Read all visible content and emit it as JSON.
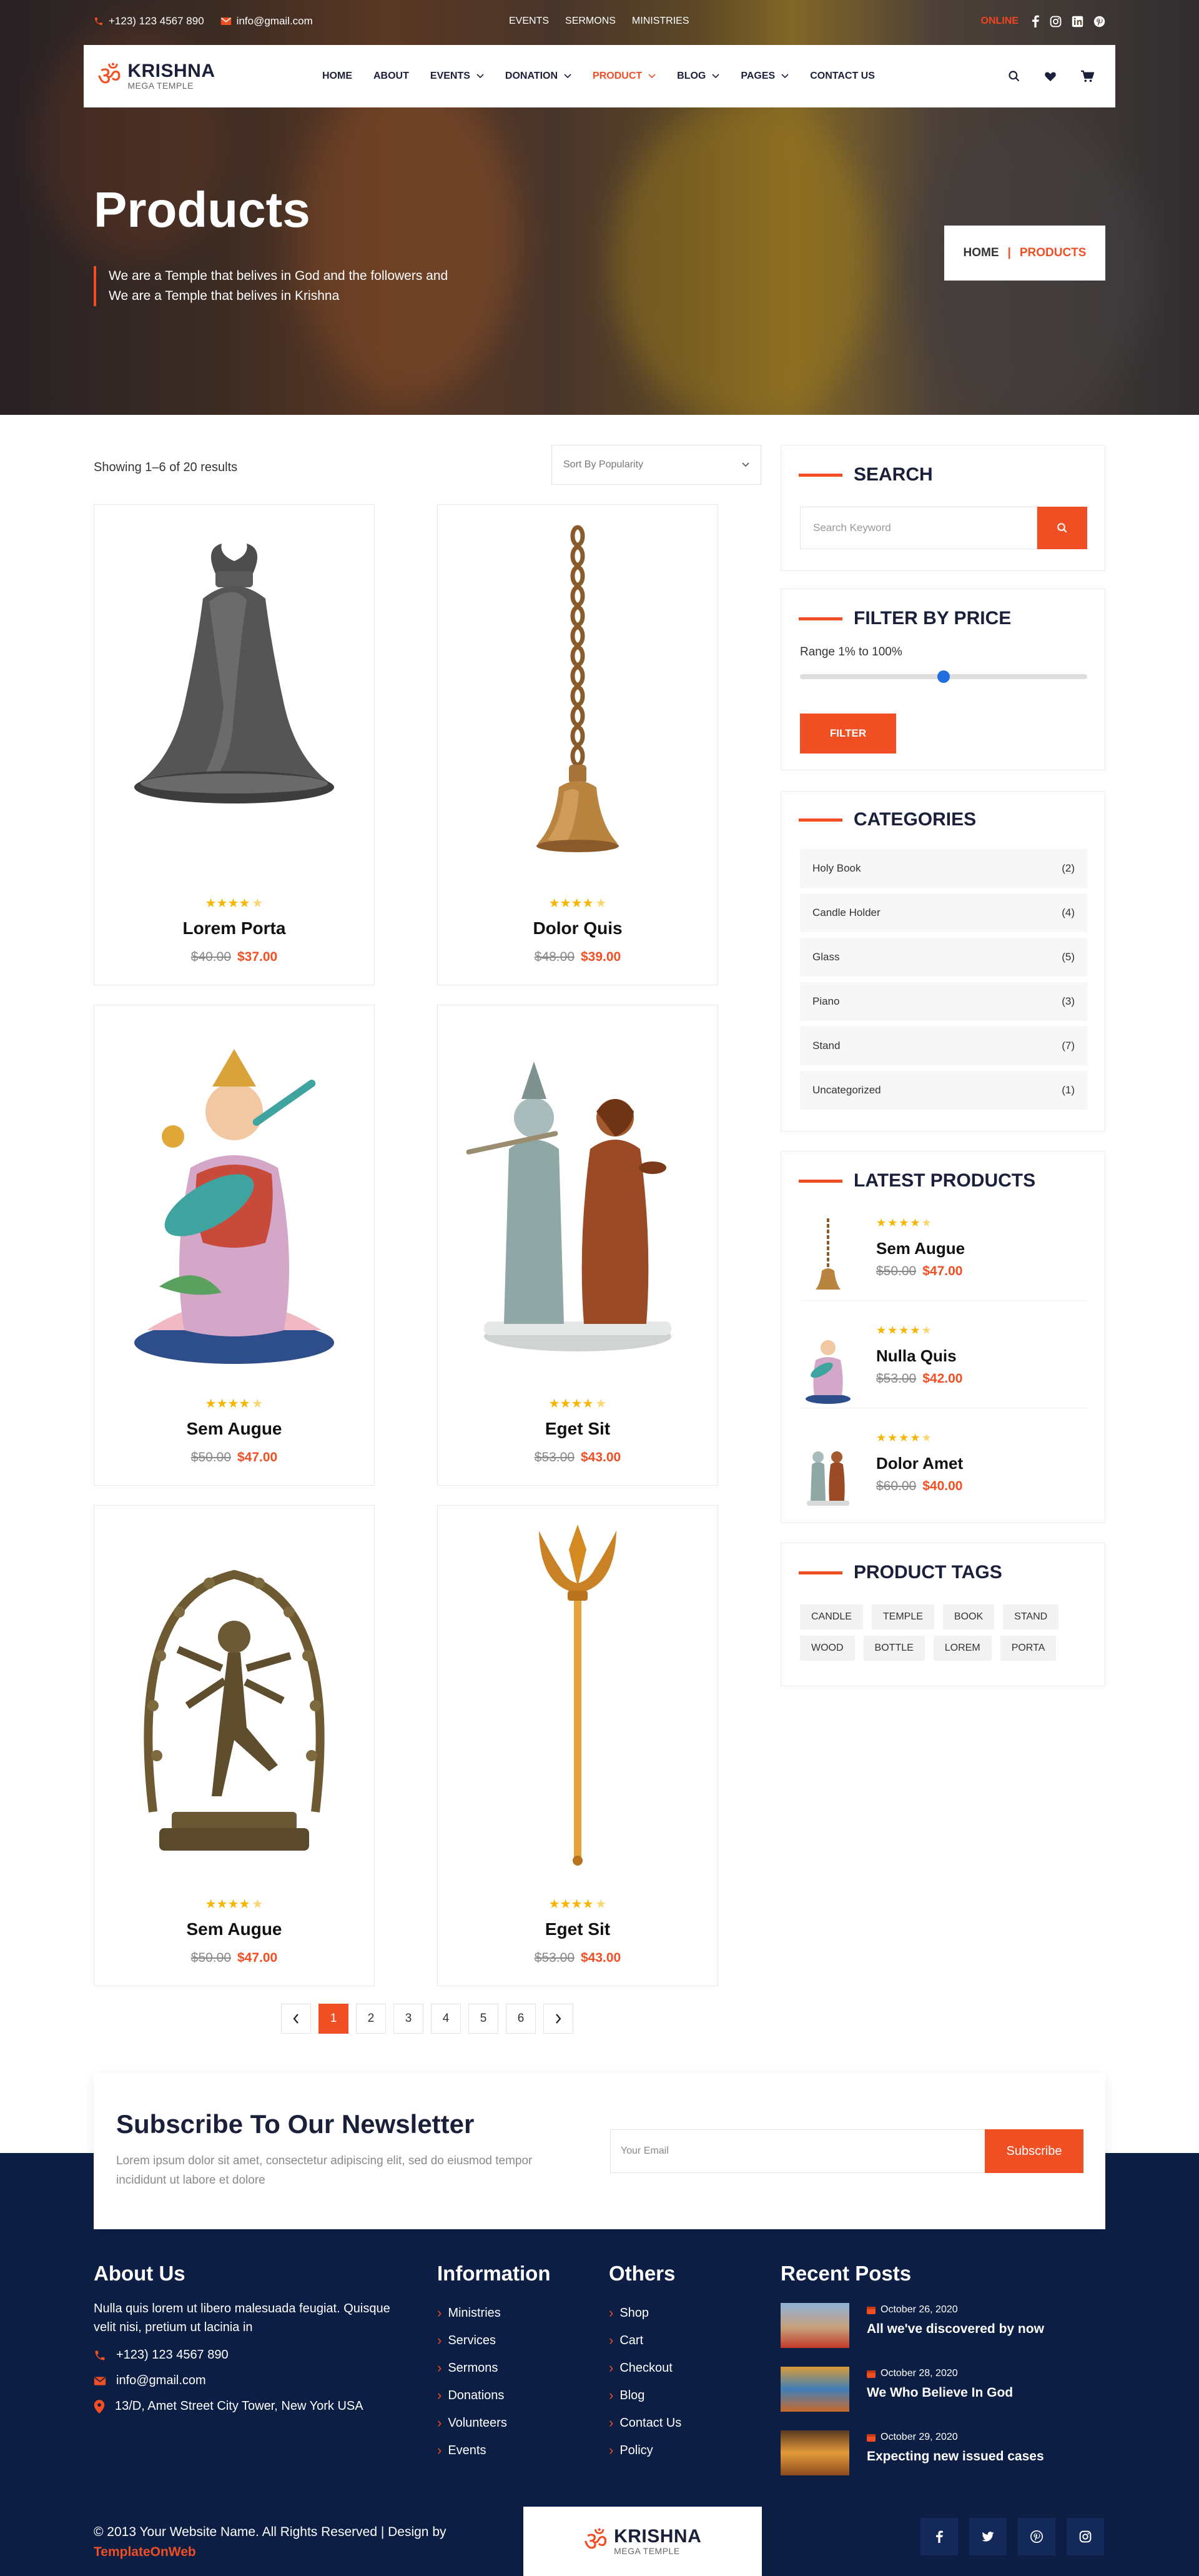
{
  "topbar": {
    "phone": "+123) 123 4567 890",
    "email": "info@gmail.com",
    "links": [
      "EVENTS",
      "SERMONS",
      "MINISTRIES"
    ],
    "online": "ONLINE"
  },
  "brand": {
    "symbol": "ॐ",
    "name": "KRISHNA",
    "tagline": "MEGA TEMPLE"
  },
  "nav": {
    "items": [
      {
        "label": "HOME"
      },
      {
        "label": "ABOUT"
      },
      {
        "label": "EVENTS"
      },
      {
        "label": "DONATION"
      },
      {
        "label": "PRODUCT"
      },
      {
        "label": "BLOG"
      },
      {
        "label": "PAGES"
      },
      {
        "label": "CONTACT US"
      }
    ]
  },
  "hero": {
    "title": "Products",
    "description": "We are a Temple that belives in God and the followers and We are a Temple that belives in Krishna",
    "breadcrumb": {
      "home": "HOME",
      "sep": "|",
      "current": "PRODUCTS"
    }
  },
  "shop": {
    "result_count": "Showing 1–6 of 20 results",
    "sort_selected": "Sort By Popularity",
    "products": [
      {
        "name": "Lorem Porta",
        "old_price": "$40.00",
        "price": "$37.00",
        "rating": 4.5
      },
      {
        "name": "Dolor Quis",
        "old_price": "$48.00",
        "price": "$39.00",
        "rating": 4.5
      },
      {
        "name": "Sem Augue",
        "old_price": "$50.00",
        "price": "$47.00",
        "rating": 4.5
      },
      {
        "name": "Eget Sit",
        "old_price": "$53.00",
        "price": "$43.00",
        "rating": 4.5
      },
      {
        "name": "Sem Augue",
        "old_price": "$50.00",
        "price": "$47.00",
        "rating": 4.5
      },
      {
        "name": "Eget Sit",
        "old_price": "$53.00",
        "price": "$43.00",
        "rating": 4.5
      }
    ],
    "pagination": {
      "prev": "‹",
      "pages": [
        "1",
        "2",
        "3",
        "4",
        "5",
        "6"
      ],
      "current": "1",
      "next": "›"
    }
  },
  "sidebar": {
    "search": {
      "title": "SEARCH",
      "placeholder": "Search Keyword"
    },
    "price": {
      "title": "FILTER BY PRICE",
      "range_text": "Range 1% to 100%",
      "slider_value": 0.5,
      "button": "FILTER"
    },
    "categories": {
      "title": "CATEGORIES",
      "items": [
        {
          "name": "Holy Book",
          "count": "(2)"
        },
        {
          "name": "Candle Holder",
          "count": "(4)"
        },
        {
          "name": "Glass",
          "count": "(5)"
        },
        {
          "name": "Piano",
          "count": "(3)"
        },
        {
          "name": "Stand",
          "count": "(7)"
        },
        {
          "name": "Uncategorized",
          "count": "(1)"
        }
      ]
    },
    "latest": {
      "title": "LATEST PRODUCTS",
      "items": [
        {
          "name": "Sem Augue",
          "old_price": "$50.00",
          "price": "$47.00"
        },
        {
          "name": "Nulla Quis",
          "old_price": "$53.00",
          "price": "$42.00"
        },
        {
          "name": "Dolor Amet",
          "old_price": "$60.00",
          "price": "$40.00"
        }
      ]
    },
    "tags": {
      "title": "PRODUCT TAGS",
      "items": [
        "CANDLE",
        "TEMPLE",
        "BOOK",
        "STAND",
        "WOOD",
        "BOTTLE",
        "LOREM",
        "PORTA"
      ]
    }
  },
  "newsletter": {
    "title": "Subscribe To Our Newsletter",
    "text": "Lorem ipsum dolor sit amet, consectetur adipiscing elit, sed do eiusmod tempor incididunt ut labore et dolore",
    "placeholder": "Your Email",
    "button": "Subscribe"
  },
  "footer": {
    "about": {
      "title": "About Us",
      "text": "Nulla quis lorem ut libero malesuada feugiat. Quisque velit nisi, pretium ut lacinia in",
      "phone": "+123) 123 4567 890",
      "email": "info@gmail.com",
      "address": "13/D, Amet Street City Tower, New York USA"
    },
    "information": {
      "title": "Information",
      "links": [
        "Ministries",
        "Services",
        "Sermons",
        "Donations",
        "Volunteers",
        "Events"
      ]
    },
    "others": {
      "title": "Others",
      "links": [
        "Shop",
        "Cart",
        "Checkout",
        "Blog",
        "Contact Us",
        "Policy"
      ]
    },
    "recent": {
      "title": "Recent Posts",
      "posts": [
        {
          "date": "October 26, 2020",
          "title": "All we've discovered by now"
        },
        {
          "date": "October 28, 2020",
          "title": "We Who Believe In God"
        },
        {
          "date": "October 29, 2020",
          "title": "Expecting new issued cases"
        }
      ]
    },
    "copyright": "© 2013 Your Website Name. All Rights Reserved | Design by",
    "designer": "TemplateOnWeb"
  },
  "colors": {
    "accent": "#f04e23",
    "navy": "#0c1e44",
    "star": "#f7b500"
  }
}
